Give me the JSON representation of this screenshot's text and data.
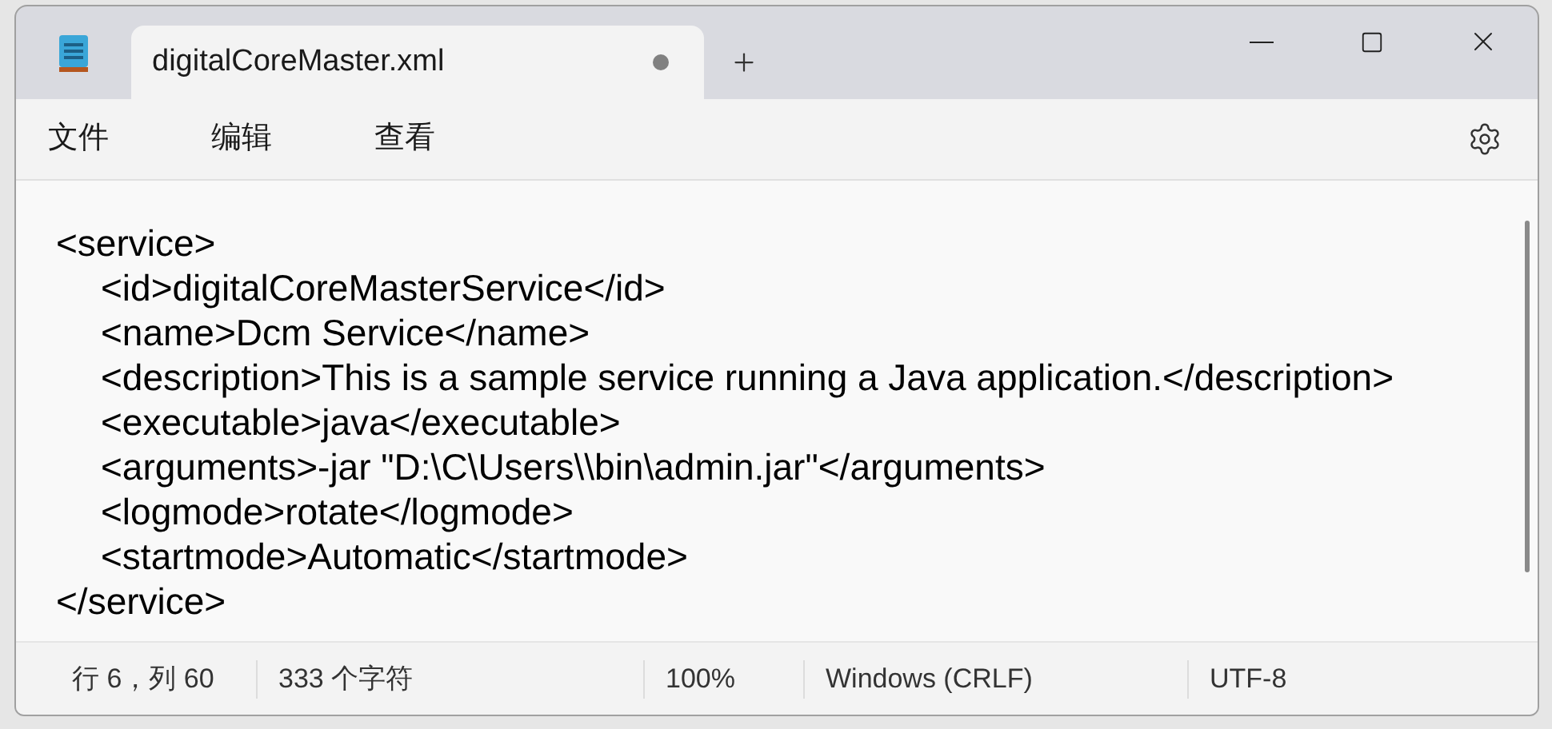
{
  "tab": {
    "title": "digitalCoreMaster.xml",
    "modified": true,
    "selected": true
  },
  "menu": [
    "文件",
    "编辑",
    "查看"
  ],
  "editor": {
    "lines": [
      {
        "text": "<service>",
        "children": [
          {
            "text": "<id>digitalCoreMasterService</id>"
          },
          {
            "text": "<name>Dcm Service</name>"
          },
          {
            "text": "<description>This is a sample service running a Java application.</description>"
          },
          {
            "text": "<executable>java</executable>"
          },
          {
            "text": "<arguments>-jar \"D:\\C\\Users\\\\bin\\admin.jar\"</arguments>"
          },
          {
            "text": "<logmode>rotate</logmode>"
          },
          {
            "text": "<startmode>Automatic</startmode>"
          }
        ]
      },
      {
        "text": "</service>"
      }
    ]
  },
  "status_bar": [
    "行 6，列 60",
    "333 个字符",
    "100%",
    "Windows (CRLF)",
    "UTF-8"
  ]
}
